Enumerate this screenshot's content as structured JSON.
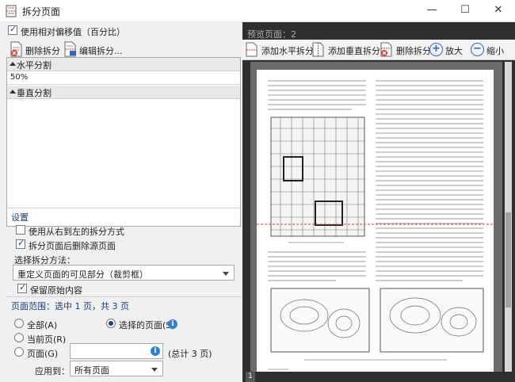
{
  "window": {
    "title": "拆分页面",
    "minimize_glyph": "—",
    "maximize_glyph": "☐",
    "close_glyph": "✕"
  },
  "left": {
    "use_relative_offset_label": "使用相对偏移值（百分比）",
    "use_relative_offset_checked": true,
    "delete_split_label": "删除拆分",
    "edit_split_label": "编辑拆分...",
    "horizontal_group": "水平分割",
    "horizontal_value": "50%",
    "vertical_group": "垂直分割",
    "settings_title": "设置",
    "rtl_label": "使用从右到左的拆分方式",
    "rtl_checked": false,
    "delete_source_label": "拆分页面后删除源页面",
    "delete_source_checked": true,
    "split_method_label": "选择拆分方法：",
    "split_method_value": "重定义页面的可见部分（裁剪框）",
    "keep_blank_label": "保留原始内容",
    "keep_blank_checked": true,
    "range_title": "页面范围：选中 1 页，共 3 页",
    "radio_all": "全部(A)",
    "radio_selected": "选择的页面(S)",
    "radio_current": "当前页(R)",
    "radio_pages": "页面(G)",
    "selected_radio": "selected",
    "pages_input_value": "",
    "total_pages": "(总计 3 页)",
    "apply_to_label": "应用到：",
    "apply_to_value": "所有页面"
  },
  "right": {
    "preview_label": "预览页面：2",
    "add_horizontal": "添加水平拆分",
    "add_vertical": "添加垂直拆分",
    "delete_split": "删除拆分",
    "zoom_in": "放大",
    "zoom_out": "缩小",
    "page_tab": "1"
  },
  "colors": {
    "accent": "#1d3d7a",
    "split_line": "#e03c3c",
    "info": "#2f7fd6"
  },
  "icons": {
    "app": "split-page-icon",
    "delete_split": "delete-split-icon",
    "edit_split": "edit-split-icon",
    "add_horizontal": "add-horizontal-split-icon",
    "add_vertical": "add-vertical-split-icon",
    "zoom_in": "plus-circle-icon",
    "zoom_out": "minus-circle-icon",
    "info": "info-icon"
  }
}
